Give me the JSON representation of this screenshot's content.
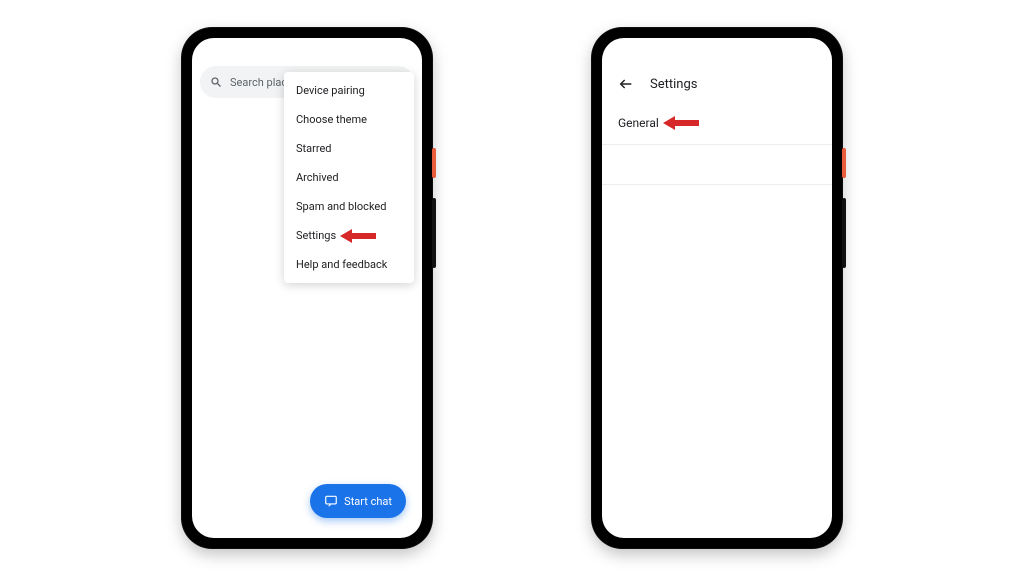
{
  "phone1": {
    "search_placeholder": "Search places",
    "menu": {
      "items": [
        "Device pairing",
        "Choose theme",
        "Starred",
        "Archived",
        "Spam and blocked",
        "Settings",
        "Help and feedback"
      ],
      "highlight_index": 5
    },
    "fab_label": "Start chat"
  },
  "phone2": {
    "appbar_title": "Settings",
    "items": [
      "General"
    ],
    "highlight_index": 0
  }
}
